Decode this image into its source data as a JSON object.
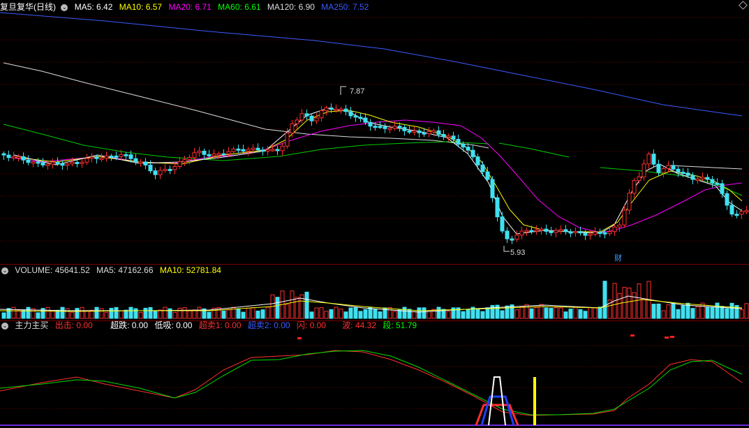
{
  "main": {
    "title": "复旦复华(日线)",
    "indicators": [
      {
        "label": "MA5: 6.42",
        "color": "#ffffff"
      },
      {
        "label": "MA10: 6.57",
        "color": "#ffff00"
      },
      {
        "label": "MA20: 6.71",
        "color": "#ff00ff"
      },
      {
        "label": "MA60: 6.61",
        "color": "#00ff00"
      },
      {
        "label": "MA120: 6.90",
        "color": "#dddddd"
      },
      {
        "label": "MA250: 7.52",
        "color": "#3b5bff"
      }
    ],
    "high_label": "7.87",
    "low_label": "5.93",
    "event_marker": "财"
  },
  "volume": {
    "indicators": [
      {
        "label": "VOLUME: 45641.52",
        "color": "#dddddd"
      },
      {
        "label": "MA5: 47162.66",
        "color": "#dddddd"
      },
      {
        "label": "MA10: 52781.84",
        "color": "#ffff00"
      }
    ]
  },
  "indicator": {
    "name": "主力主买",
    "fields": [
      {
        "label": "出击: 0.00",
        "color": "#ff3030"
      },
      {
        "label": "超跌: 0.00",
        "color": "#ffffff"
      },
      {
        "label": "低吸: 0.00",
        "color": "#ffffff"
      },
      {
        "label": "超卖1: 0.00",
        "color": "#ff3030"
      },
      {
        "label": "超卖2: 0.00",
        "color": "#3b5bff"
      },
      {
        "label": "闪: 0.00",
        "color": "#ff3030"
      },
      {
        "label": "波: 44.32",
        "color": "#ff3030"
      },
      {
        "label": "段: 51.79",
        "color": "#00ff00"
      }
    ]
  },
  "colors": {
    "up": "#ff3030",
    "down": "#40e0f0",
    "grid": "#7a0000"
  }
}
